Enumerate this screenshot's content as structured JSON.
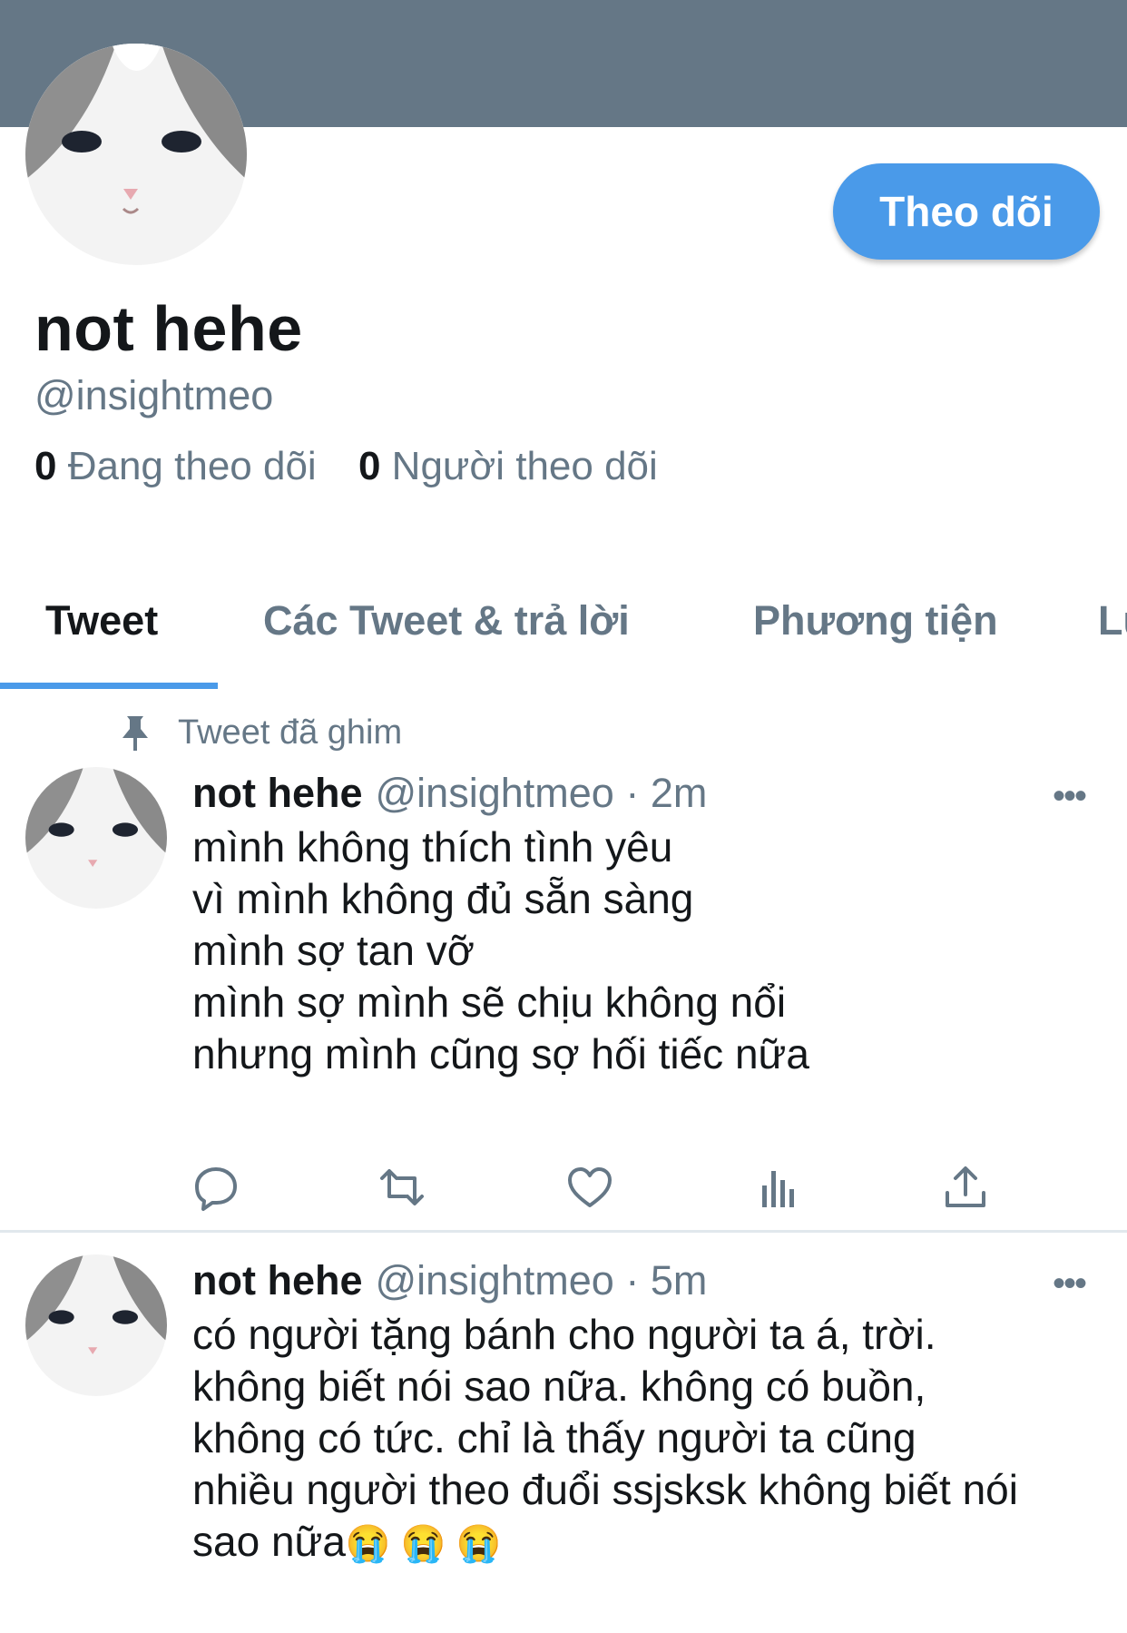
{
  "profile": {
    "name": "not hehe",
    "handle": "@insightmeo",
    "following_count": "0",
    "following_label": "Đang theo dõi",
    "followers_count": "0",
    "followers_label": "Người theo dõi",
    "follow_button": "Theo dõi",
    "avatar_icon": "cat-avatar"
  },
  "tabs": [
    {
      "label": "Tweet",
      "active": true
    },
    {
      "label": "Các Tweet & trả lời",
      "active": false
    },
    {
      "label": "Phương tiện",
      "active": false
    },
    {
      "label": "Lượt thích",
      "active": false
    }
  ],
  "pinned_label": "Tweet đã ghim",
  "tweets": [
    {
      "name": "not hehe",
      "handle": "@insightmeo",
      "time": "· 2m",
      "text": "mình không thích tình yêu\nvì mình không đủ sẵn sàng\nmình sợ tan vỡ\nmình sợ mình sẽ chịu không nổi\nnhưng mình cũng sợ hối tiếc nữa",
      "more": "•••"
    },
    {
      "name": "not hehe",
      "handle": "@insightmeo",
      "time": "· 5m",
      "text": "có người tặng bánh cho người ta á, trời.\nkhông biết nói sao nữa. không có buồn,\nkhông có tức. chỉ là thấy người ta cũng\nnhiều người theo đuổi ssjsksk không biết nói\nsao nữa",
      "emoji": "😭 😭 😭",
      "more": "•••"
    }
  ],
  "actions": [
    "reply-icon",
    "retweet-icon",
    "like-icon",
    "analytics-icon",
    "share-icon"
  ],
  "colors": {
    "accent": "#4a9ae9",
    "banner": "#657786",
    "secondary_text": "#657786"
  }
}
